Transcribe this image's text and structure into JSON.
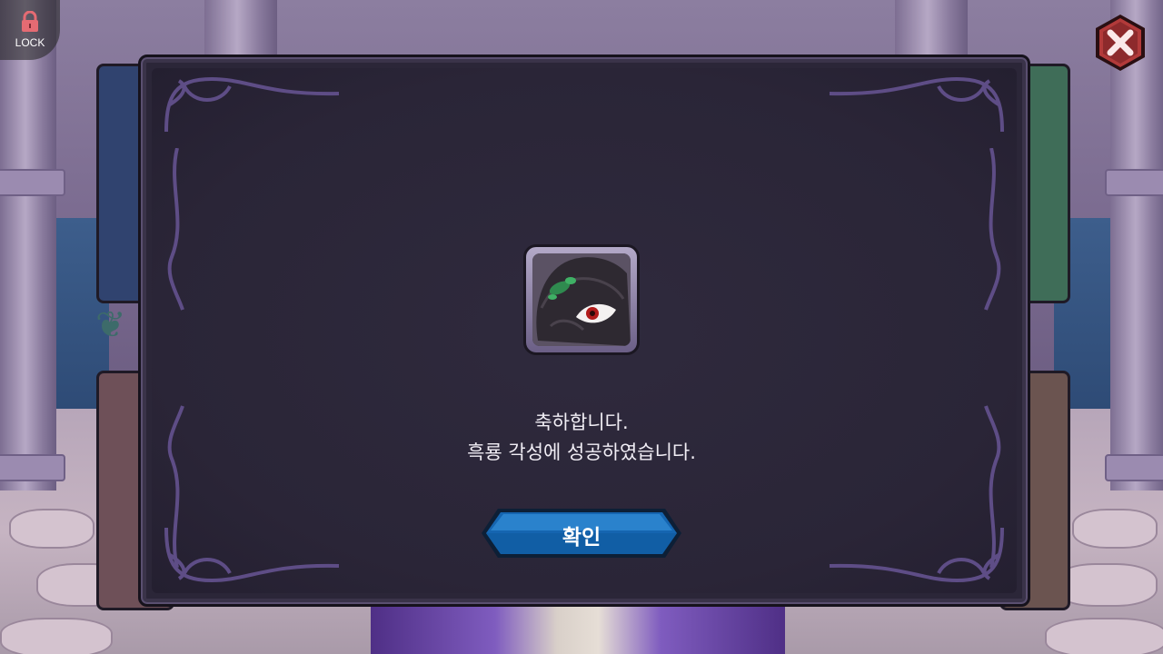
{
  "hud": {
    "lock_label": "LOCK",
    "lock_icon": "lock-icon",
    "close_icon": "close-icon"
  },
  "dialog": {
    "portrait_icon": "black-dragon-portrait",
    "message_line1": "축하합니다.",
    "message_line2": "흑룡 각성에 성공하였습니다.",
    "confirm_label": "확인"
  },
  "colors": {
    "dialog_bg": "#2b2638",
    "confirm_button": "#1565b0",
    "close_button": "#b23a3a",
    "lock_icon": "#e56b73"
  }
}
